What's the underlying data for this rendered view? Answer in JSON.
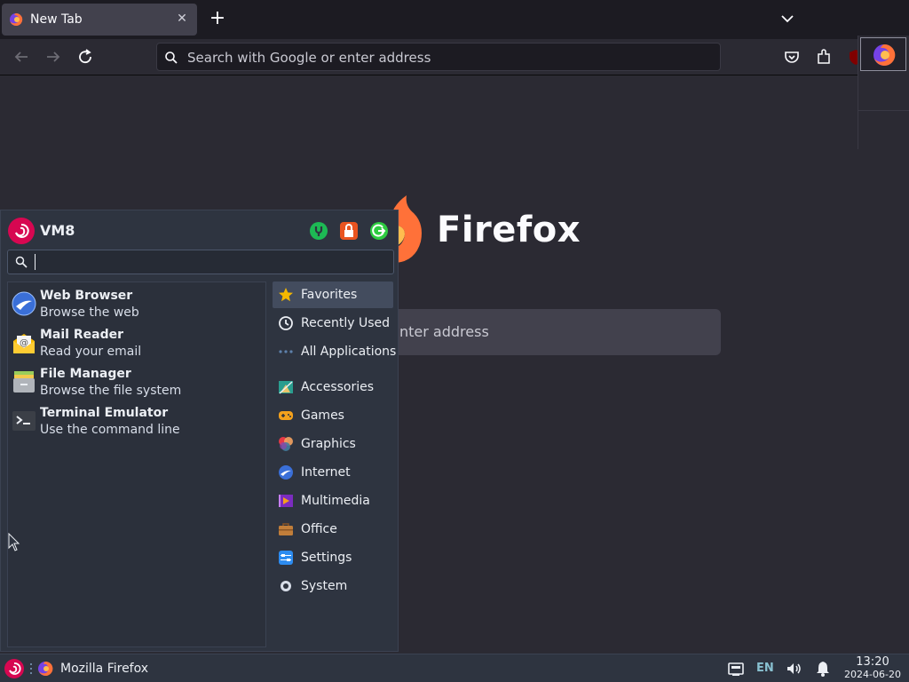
{
  "browser": {
    "tab": {
      "title": "New Tab",
      "close": "✕"
    },
    "newtab_button": "+",
    "urlbar": {
      "placeholder": "Search with Google or enter address"
    },
    "newtab_page": {
      "wordmark": "Firefox",
      "search_placeholder_visible": "nter address"
    }
  },
  "whisker_menu": {
    "username": "VM8",
    "search": {
      "value": ""
    },
    "apps": [
      {
        "name": "Web Browser",
        "desc": "Browse the web",
        "icon": "web-browser-icon"
      },
      {
        "name": "Mail Reader",
        "desc": "Read your email",
        "icon": "mail-reader-icon"
      },
      {
        "name": "File Manager",
        "desc": "Browse the file system",
        "icon": "file-manager-icon"
      },
      {
        "name": "Terminal Emulator",
        "desc": "Use the command line",
        "icon": "terminal-icon"
      }
    ],
    "categories": [
      {
        "label": "Favorites",
        "icon": "star-icon",
        "active": true
      },
      {
        "label": "Recently Used",
        "icon": "clock-icon"
      },
      {
        "label": "All Applications",
        "icon": "dots-icon"
      },
      {
        "label": "Accessories",
        "icon": "accessories-icon"
      },
      {
        "label": "Games",
        "icon": "gamepad-icon"
      },
      {
        "label": "Graphics",
        "icon": "graphics-icon"
      },
      {
        "label": "Internet",
        "icon": "internet-icon"
      },
      {
        "label": "Multimedia",
        "icon": "multimedia-icon"
      },
      {
        "label": "Office",
        "icon": "briefcase-icon"
      },
      {
        "label": "Settings",
        "icon": "settings-icon"
      },
      {
        "label": "System",
        "icon": "system-icon"
      }
    ]
  },
  "taskbar": {
    "window_title": "Mozilla Firefox",
    "keyboard_layout": "EN",
    "clock_time": "13:20",
    "clock_date": "2024-06-20"
  },
  "colors": {
    "firefox_orange": "#ff7139",
    "debian_red": "#d70751",
    "accent_blue": "#88c0d0"
  }
}
